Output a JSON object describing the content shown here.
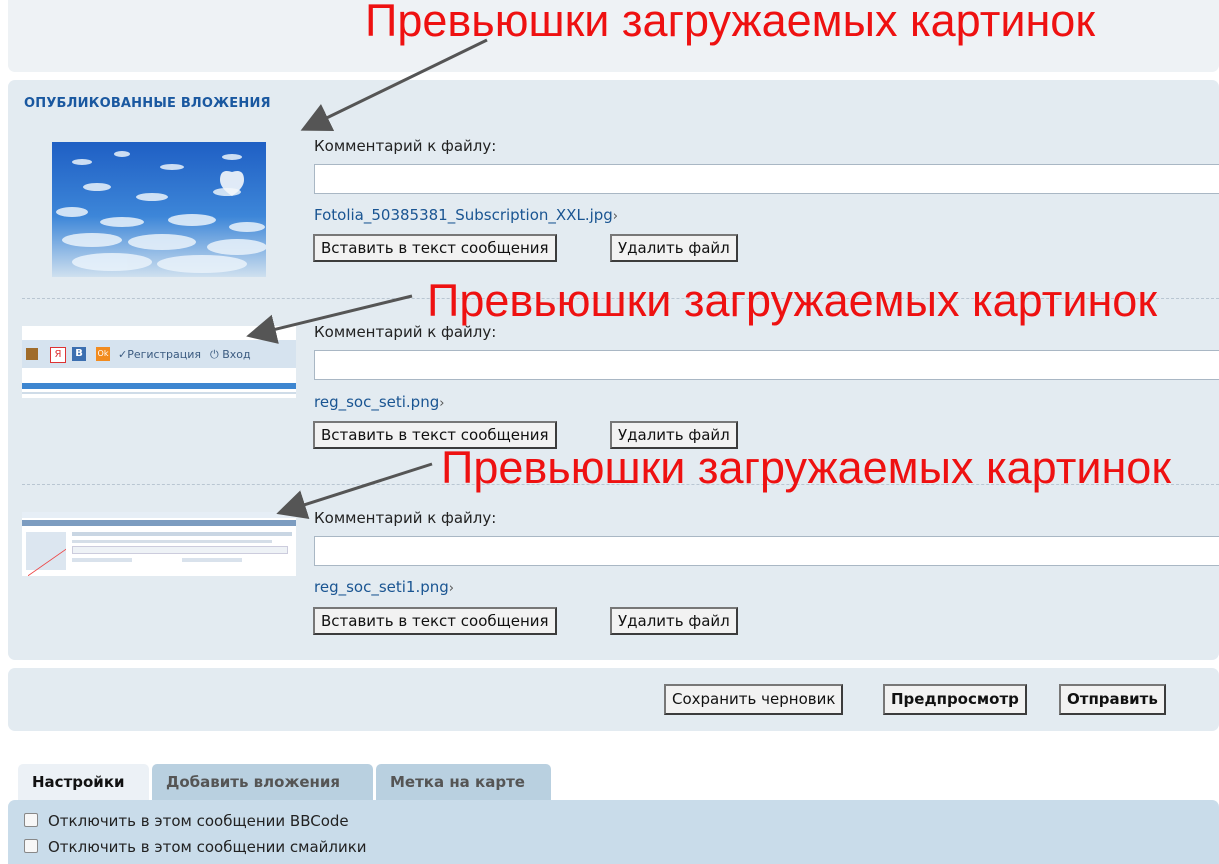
{
  "section_title": "ОПУБЛИКОВАННЫЕ ВЛОЖЕНИЯ",
  "annotation": "Превьюшки загружаемых картинок",
  "comment_label": "Комментарий к файлу:",
  "insert_label": "Вставить в текст сообщения",
  "delete_label": "Удалить файл",
  "attachments": [
    {
      "filename": "Fotolia_50385381_Subscription_XXL.jpg",
      "comment": ""
    },
    {
      "filename": "reg_soc_seti.png",
      "comment": ""
    },
    {
      "filename": "reg_soc_seti1.png",
      "comment": ""
    }
  ],
  "thumb2": {
    "register": "Регистрация",
    "login": "Вход",
    "icons": [
      "Я",
      "В",
      "Ok"
    ]
  },
  "actions": {
    "save_draft": "Сохранить черновик",
    "preview": "Предпросмотр",
    "send": "Отправить"
  },
  "tabs": [
    "Настройки",
    "Добавить вложения",
    "Метка на карте"
  ],
  "options": [
    "Отключить в этом сообщении BBCode",
    "Отключить в этом сообщении смайлики"
  ],
  "colors": {
    "accent": "#1a58a0",
    "annotation": "#ee1111",
    "link": "#1a5592"
  }
}
